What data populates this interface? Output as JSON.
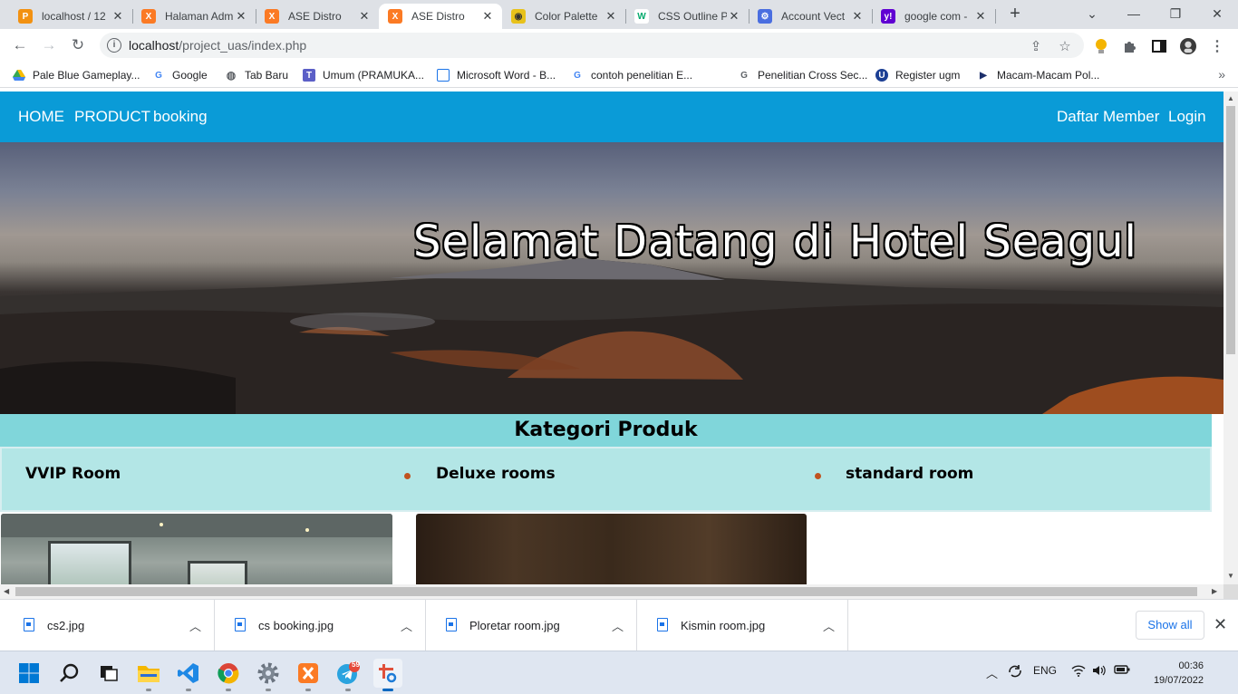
{
  "tabs": [
    {
      "title": "localhost / 12",
      "favicon": "phpmyadmin-icon",
      "color": "#f29111"
    },
    {
      "title": "Halaman Adm",
      "favicon": "xampp-icon",
      "color": "#fb7a24"
    },
    {
      "title": "ASE Distro",
      "favicon": "xampp-icon",
      "color": "#fb7a24"
    },
    {
      "title": "ASE Distro",
      "favicon": "xampp-icon",
      "color": "#fb7a24",
      "active": true
    },
    {
      "title": "Color Palette",
      "favicon": "palette-icon",
      "color": "#e8c21b"
    },
    {
      "title": "CSS Outline P",
      "favicon": "w3schools-icon",
      "color": "#04aa6d"
    },
    {
      "title": "Account Vect",
      "favicon": "gear-icon",
      "color": "#4a6ee0"
    },
    {
      "title": "google com -",
      "favicon": "yahoo-icon",
      "color": "#6001d2"
    }
  ],
  "address": {
    "host": "localhost",
    "path": "/project_uas/index.php"
  },
  "bookmarks": [
    {
      "label": "Pale Blue Gameplay...",
      "icon": "drive-icon"
    },
    {
      "label": "Google",
      "icon": "google-icon"
    },
    {
      "label": "Tab Baru",
      "icon": "globe-icon"
    },
    {
      "label": "Umum (PRAMUKA...",
      "icon": "teams-icon"
    },
    {
      "label": "Microsoft Word - B...",
      "icon": "document-icon"
    },
    {
      "label": "contoh penelitian E...",
      "icon": "google-icon"
    },
    {
      "label": "Penelitian Cross Sec...",
      "icon": "google-icon"
    },
    {
      "label": "Register ugm",
      "icon": "ugm-icon"
    },
    {
      "label": "Macam-Macam Pol...",
      "icon": "bookmark-icon"
    }
  ],
  "site": {
    "nav_left": [
      "HOME",
      "PRODUCT",
      "booking"
    ],
    "nav_right": [
      "Daftar Member",
      "Login"
    ],
    "hero_title": "Selamat Datang di Hotel Seagul",
    "category_title": "Kategori Produk",
    "categories": [
      "VVIP Room",
      "Deluxe rooms",
      "standard room"
    ],
    "nav_color": "#0a9bd7",
    "category_bg": "#80d6da"
  },
  "downloads": [
    "cs2.jpg",
    "cs booking.jpg",
    "Ploretar room.jpg",
    "Kismin room.jpg"
  ],
  "shelf": {
    "show_all": "Show all"
  },
  "taskbar": {
    "telegram_badge": "59",
    "language": "ENG",
    "time": "00:36",
    "date": "19/07/2022"
  }
}
